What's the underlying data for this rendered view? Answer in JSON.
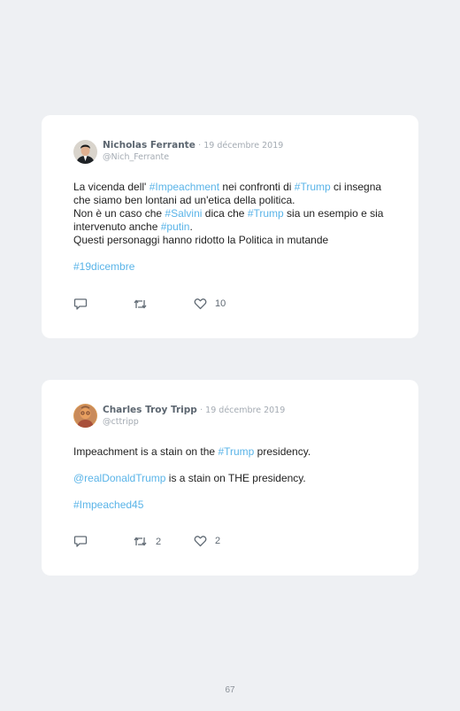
{
  "tweets": [
    {
      "name": "Nicholas Ferrante",
      "date": "· 19 décembre 2019",
      "handle": "@Nich_Ferrante",
      "paragraphs": [
        [
          {
            "t": "La vicenda dell' "
          },
          {
            "t": "#Impeachment",
            "tag": true
          },
          {
            "t": " nei confronti di "
          },
          {
            "t": "#Trump",
            "tag": true
          },
          {
            "t": " ci insegna che siamo ben lontani ad un'etica della politica."
          }
        ],
        [
          {
            "t": "Non è un caso che "
          },
          {
            "t": "#Salvini",
            "tag": true
          },
          {
            "t": " dica che "
          },
          {
            "t": "#Trump",
            "tag": true
          },
          {
            "t": " sia un esempio e sia intervenuto anche "
          },
          {
            "t": "#putin",
            "tag": true
          },
          {
            "t": "."
          }
        ],
        [
          {
            "t": "Questi personaggi hanno ridotto la Politica in mutande"
          }
        ],
        [
          {
            "t": "#19dicembre",
            "tag": true
          }
        ]
      ],
      "retweets": "",
      "likes": "10"
    },
    {
      "name": "Charles Troy Tripp",
      "date": "· 19 décembre 2019",
      "handle": "@cttripp",
      "paragraphs": [
        [
          {
            "t": "Impeachment is a stain on the "
          },
          {
            "t": "#Trump",
            "tag": true
          },
          {
            "t": " presidency."
          }
        ],
        [
          {
            "t": "@realDonaldTrump",
            "tag": true
          },
          {
            "t": " is a stain on THE presidency."
          }
        ],
        [
          {
            "t": "#Impeached45",
            "tag": true
          }
        ]
      ],
      "retweets": "2",
      "likes": "2"
    }
  ],
  "icons": [
    "reply-icon",
    "retweet-icon",
    "like-icon"
  ],
  "colors": {
    "hashtag": "#5ab4e8",
    "background": "#eef0f3"
  },
  "page_number": "67"
}
